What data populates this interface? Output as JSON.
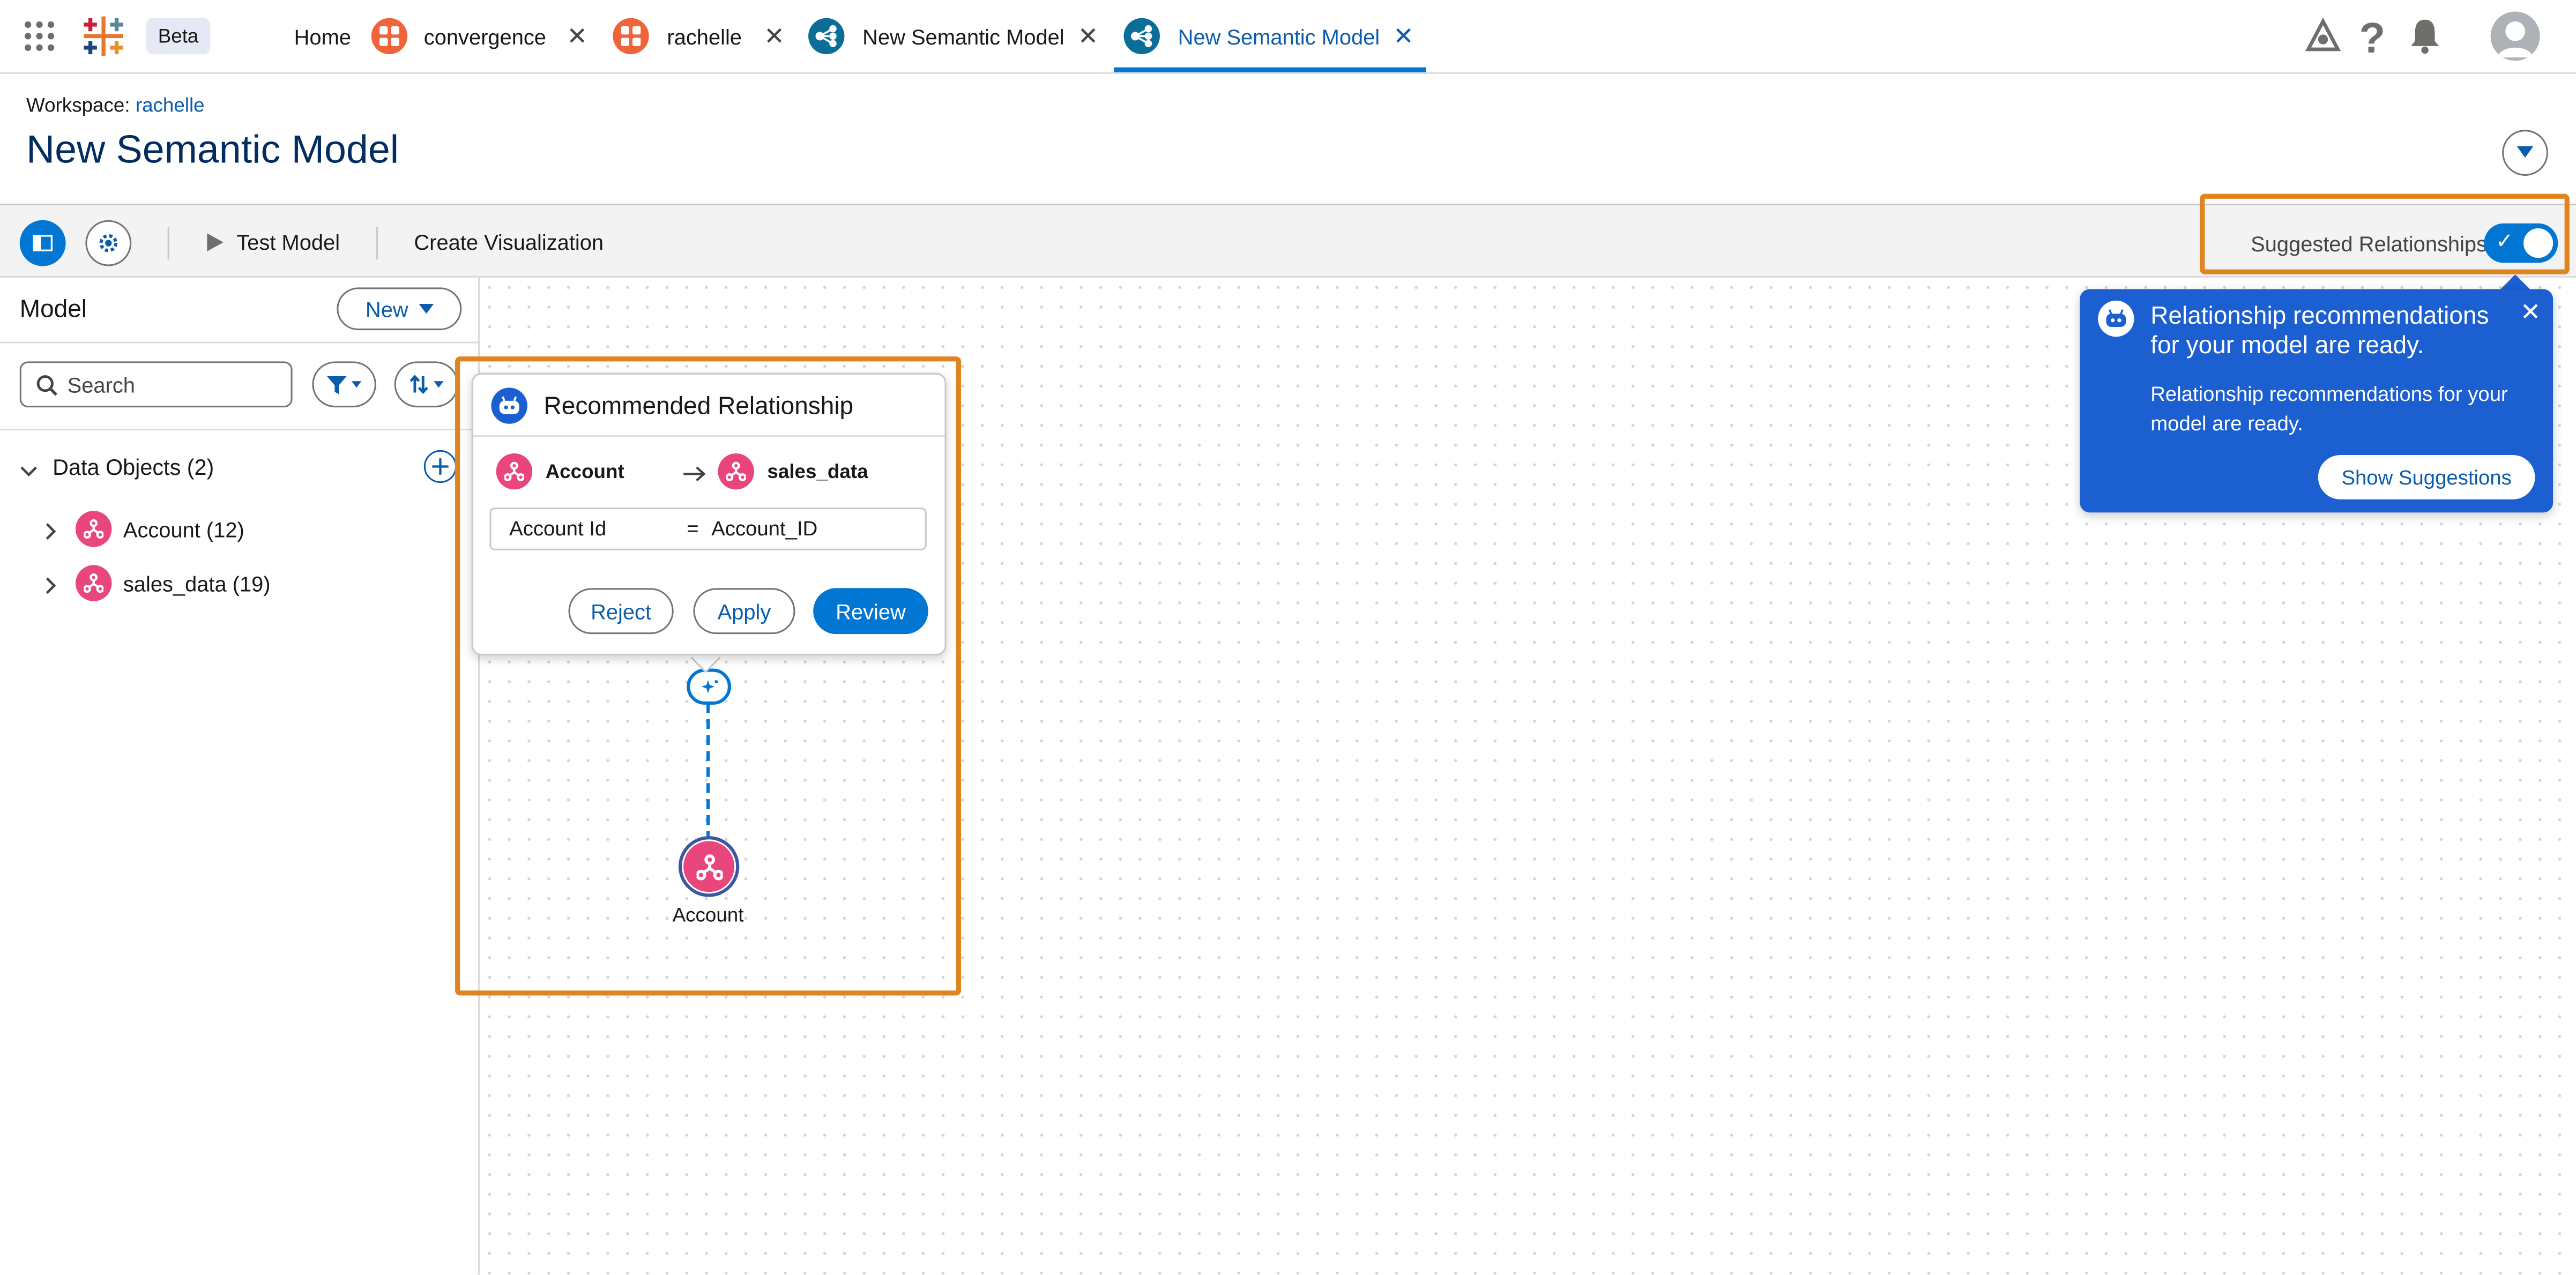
{
  "topnav": {
    "beta_label": "Beta",
    "tabs": [
      {
        "label": "Home",
        "closable": false
      },
      {
        "label": "convergence",
        "icon": "workspace-icon"
      },
      {
        "label": "rachelle",
        "icon": "workspace-icon"
      },
      {
        "label": "New Semantic Model",
        "icon": "semantic-model-icon"
      },
      {
        "label": "New Semantic Model",
        "icon": "semantic-model-icon",
        "active": true
      }
    ],
    "close_glyph": "✕"
  },
  "header": {
    "workspace_label": "Workspace:",
    "workspace_name": "rachelle",
    "title": "New Semantic Model"
  },
  "toolbar": {
    "test_model": "Test Model",
    "create_viz": "Create Visualization",
    "suggested_relationships": "Suggested Relationships",
    "suggested_enabled": true
  },
  "sidebar": {
    "title": "Model",
    "new_button": "New",
    "search_placeholder": "Search",
    "data_objects_header": "Data Objects (2)",
    "items": [
      {
        "label": "Account (12)"
      },
      {
        "label": "sales_data (19)"
      }
    ]
  },
  "rel_card": {
    "title": "Recommended Relationship",
    "from_object": "Account",
    "to_object": "sales_data",
    "from_field": "Account Id",
    "operator": "=",
    "to_field": "Account_ID",
    "reject": "Reject",
    "apply": "Apply",
    "review": "Review"
  },
  "canvas": {
    "node_label": "Account"
  },
  "popover": {
    "title": "Relationship recommendations for your model are ready.",
    "body": "Relationship recommendations for your model are ready.",
    "button": "Show Suggestions",
    "close_glyph": "✕"
  },
  "colors": {
    "brand": "#0176d3",
    "highlight": "#de8520",
    "object_pink": "#e8467c",
    "popover_blue": "#1b5fd1"
  }
}
